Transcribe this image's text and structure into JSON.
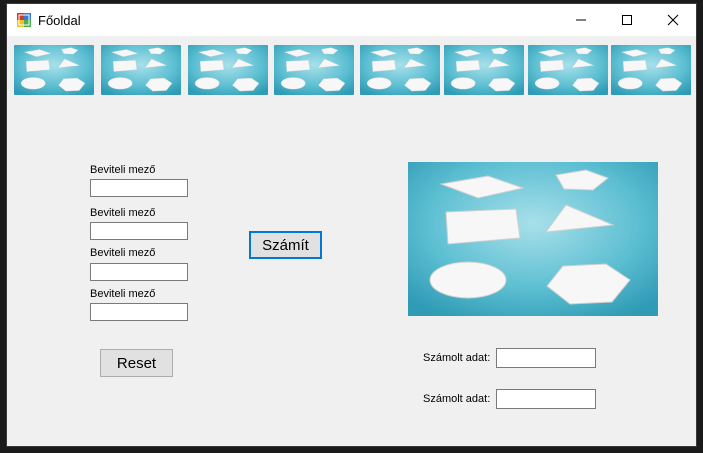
{
  "window": {
    "title": "Főoldal"
  },
  "thumbnails": [
    "shapes-thumbnail",
    "shapes-thumbnail",
    "shapes-thumbnail",
    "shapes-thumbnail",
    "shapes-thumbnail",
    "shapes-thumbnail",
    "shapes-thumbnail",
    "shapes-thumbnail"
  ],
  "inputs": [
    {
      "label": "Beviteli mező",
      "value": ""
    },
    {
      "label": "Beviteli mező",
      "value": ""
    },
    {
      "label": "Beviteli mező",
      "value": ""
    },
    {
      "label": "Beviteli mező",
      "value": ""
    }
  ],
  "buttons": {
    "calculate": "Számít",
    "reset": "Reset"
  },
  "outputs": [
    {
      "label": "Számolt adat:",
      "value": ""
    },
    {
      "label": "Számolt adat:",
      "value": ""
    }
  ],
  "colors": {
    "accent": "#0078d7",
    "image_bg": "#4fb6cc"
  }
}
